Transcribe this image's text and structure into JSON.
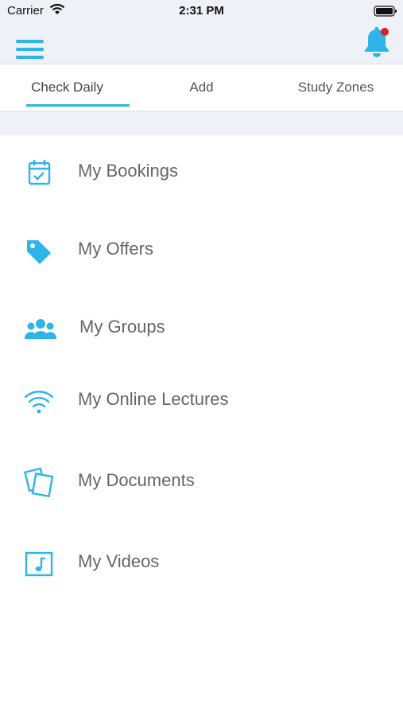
{
  "status_bar": {
    "carrier": "Carrier",
    "time": "2:31 PM"
  },
  "header": {
    "menu_icon": "hamburger-icon",
    "notification_icon": "bell-icon",
    "notification_badge_color": "#d9231c",
    "accent_color": "#2db4e8"
  },
  "tabs": [
    {
      "label": "Check Daily",
      "selected": true
    },
    {
      "label": "Add",
      "selected": false
    },
    {
      "label": "Study Zones",
      "selected": false
    }
  ],
  "menu": {
    "items": [
      {
        "label": "My Bookings",
        "icon": "calendar-check-icon"
      },
      {
        "label": "My Offers",
        "icon": "tag-icon"
      },
      {
        "label": "My Groups",
        "icon": "group-icon"
      },
      {
        "label": "My Online Lectures",
        "icon": "wifi-icon"
      },
      {
        "label": "My Documents",
        "icon": "documents-icon"
      },
      {
        "label": "My Videos",
        "icon": "video-music-icon"
      }
    ]
  }
}
